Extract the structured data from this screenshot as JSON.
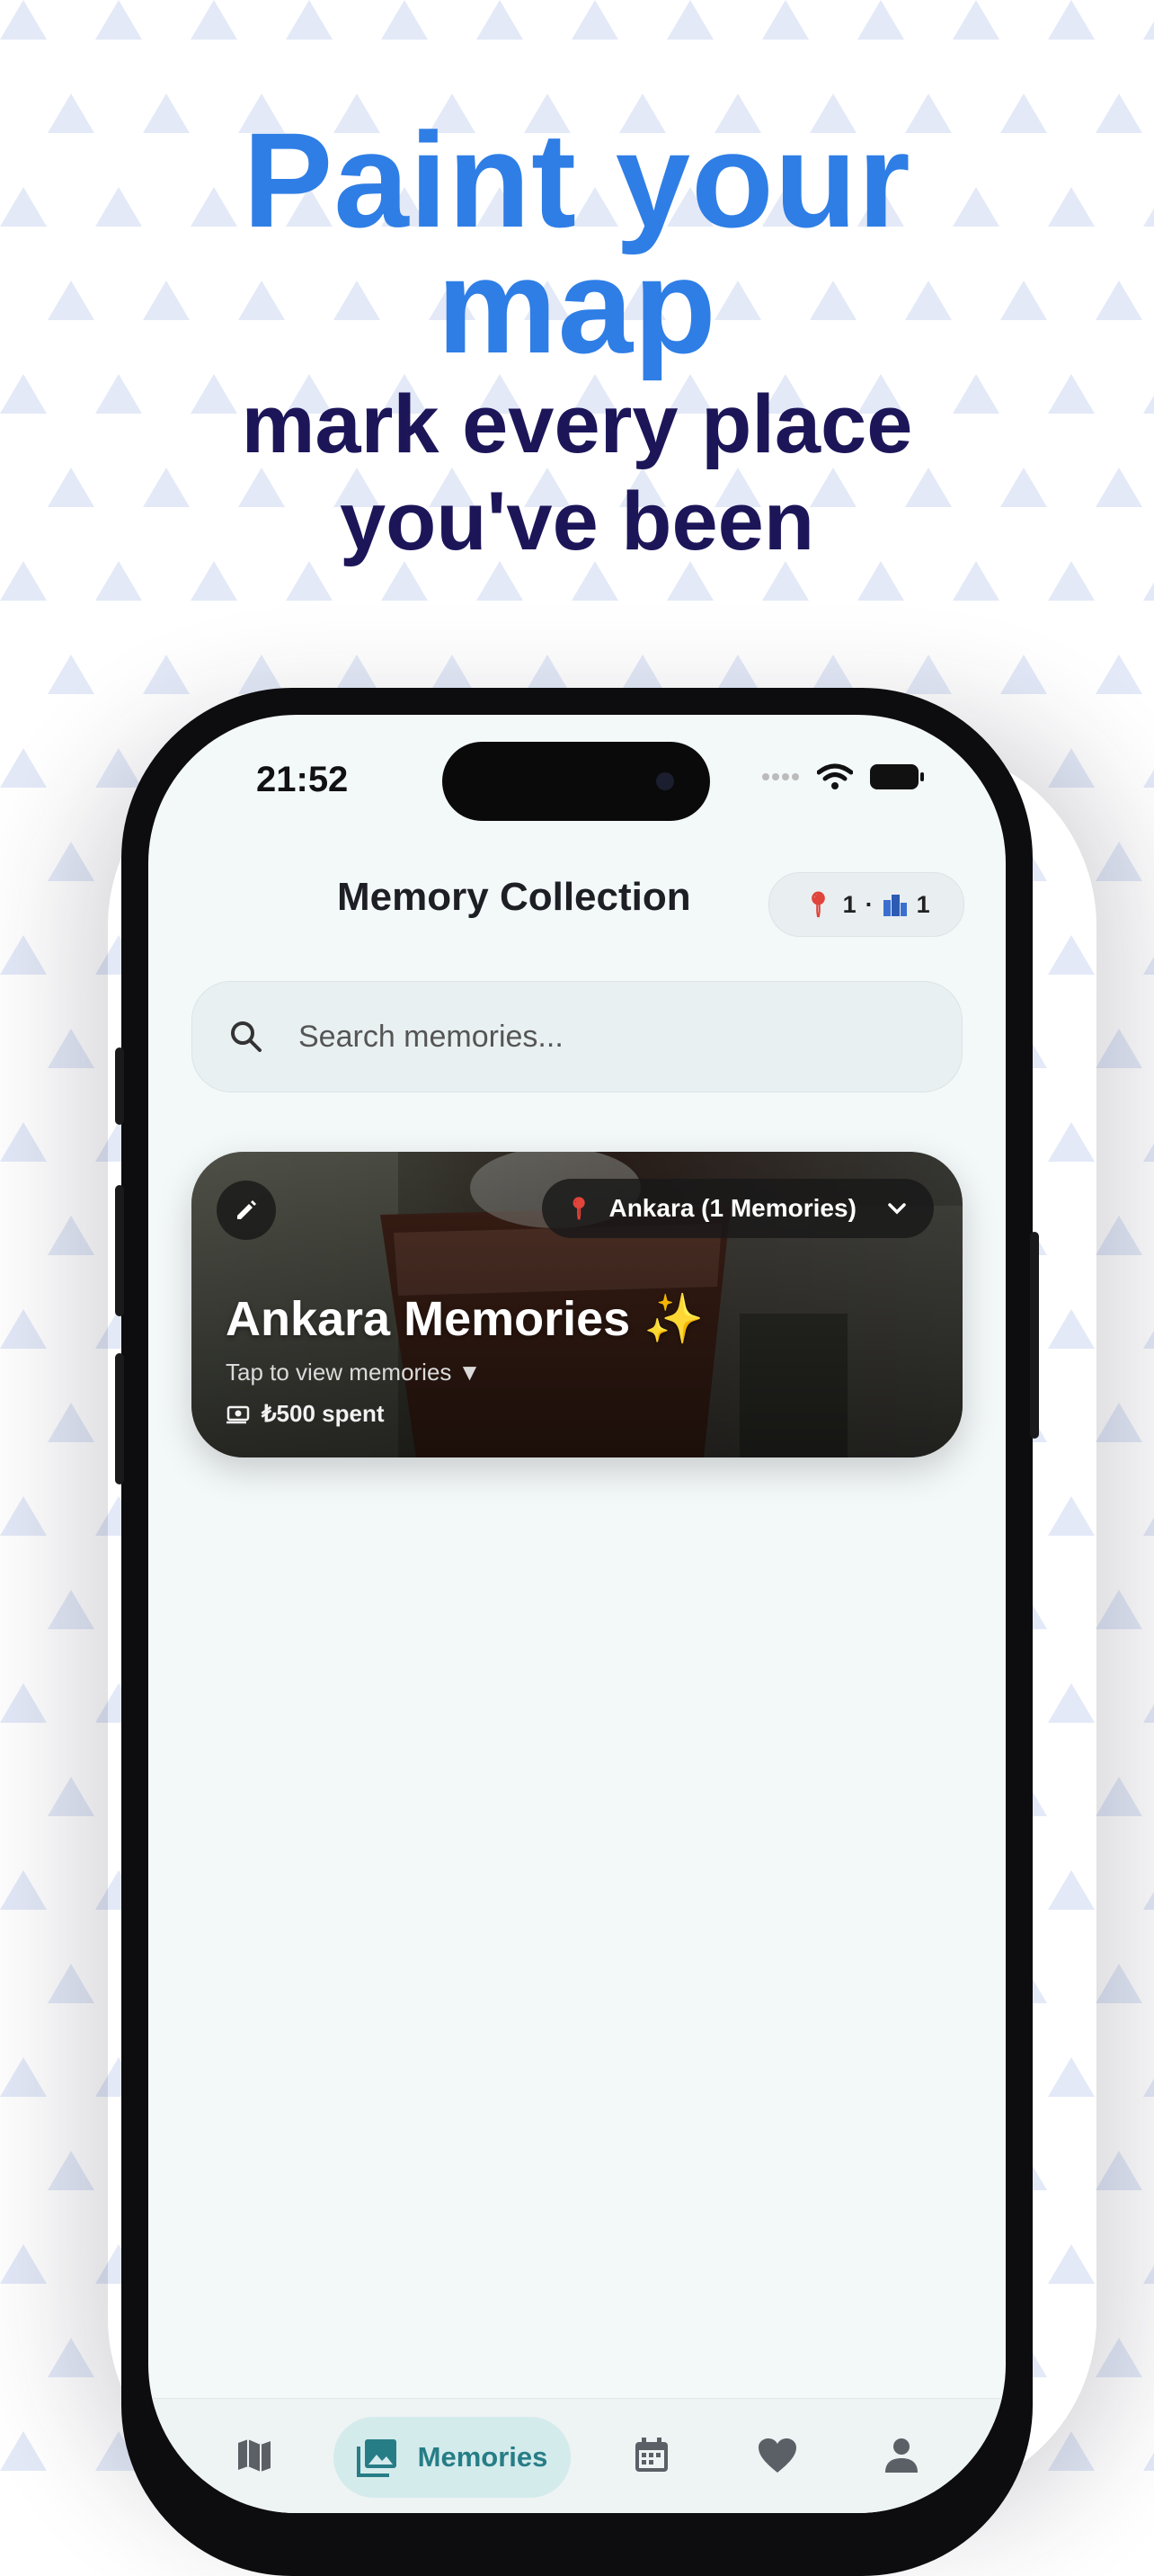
{
  "headline": {
    "line1": "Paint your",
    "line2": "map",
    "line3": "mark every place",
    "line4": "you've been"
  },
  "status_bar": {
    "time": "21:52",
    "icons": [
      "cellular-dots-icon",
      "wifi-icon",
      "battery-icon"
    ]
  },
  "header": {
    "title": "Memory Collection",
    "stats": {
      "place_icon": "pin-icon",
      "places": "1",
      "separator": "·",
      "city_icon": "city-icon",
      "cities": "1"
    }
  },
  "search": {
    "placeholder": "Search memories..."
  },
  "memory_card": {
    "location_pill": "Ankara (1 Memories)",
    "title": "Ankara Memories ✨",
    "subtitle": "Tap to view memories ▼",
    "spent": "₺500 spent"
  },
  "tab_bar": {
    "tabs": [
      {
        "icon": "map-icon",
        "label": ""
      },
      {
        "icon": "photo-icon",
        "label": "Memories",
        "active": true
      },
      {
        "icon": "calendar-icon",
        "label": ""
      },
      {
        "icon": "heart-icon",
        "label": ""
      },
      {
        "icon": "profile-icon",
        "label": ""
      }
    ]
  },
  "colors": {
    "headline_blue": "#2f7ee6",
    "headline_dark": "#1c1659",
    "accent_teal": "#277d86",
    "screen_bg": "#f3f8f9"
  }
}
